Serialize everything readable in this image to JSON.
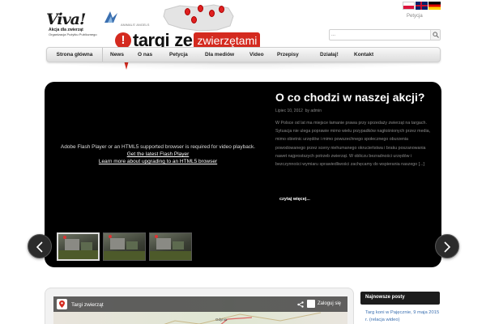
{
  "header": {
    "viva_logo": {
      "name": "Viva!",
      "tagline": "Akcja dla zwierząt",
      "subline": "Organizacja Pożytku Publicznego"
    },
    "animals_angels_logo": {
      "text": "ANIMALS' ANGELS"
    },
    "targi_logo": {
      "bang": "!",
      "word_targi": "targi",
      "word_ze": "ze",
      "word_zwierzetami": "zwierzętami"
    },
    "languages": [
      "pl",
      "en",
      "de"
    ],
    "petycja_link": "Petycja",
    "search": {
      "placeholder": "...",
      "value": ""
    }
  },
  "nav": {
    "items": [
      {
        "label": "Strona główna"
      },
      {
        "label": "News"
      },
      {
        "label": "O nas"
      },
      {
        "label": "Petycja"
      },
      {
        "label": "Dla mediów"
      },
      {
        "label": "Video"
      },
      {
        "label": "Przepisy"
      },
      {
        "label": "Działaj!"
      },
      {
        "label": "Kontakt"
      }
    ]
  },
  "slider": {
    "flash_message": "Adobe Flash Player or an HTML5 supported browser is required for video playback.",
    "flash_link1": "Get the latest Flash Player",
    "flash_link2": "Learn more about upgrading to an HTML5 browser",
    "title": "O co chodzi w naszej akcji?",
    "meta_date": "Lipiec 10, 2012",
    "meta_by": "by admin",
    "body": "W Polsce od lat ma miejsce łamanie prawa przy sprzedaży zwierząt na targach. Sytuacja nie ulega poprawie mimo wielu przypadków nagłośnionych przez media, mimo obietnic urzędów i mimo powszechnego społecznego oburzenia powodowanego przez sceny niehumanego okrucieństwa i braku poszanowania nawet najprostszych potrzeb zwierząt. W obliczu bezradności urzędów i bezczynności wymiaru sprawiedliwości zachęcamy do wspierania naszego [...]",
    "read_more": "czytaj więcej...",
    "thumbs": 3
  },
  "map": {
    "title": "Targi zwierząt",
    "login": "Zaloguj się",
    "town_label": "Gdynia"
  },
  "sidebar_widget": {
    "title": "Najnowsze posty",
    "item": "Targ koni w Pajęcznie, 9 maja 2015 r. (relacja wideo)"
  },
  "colors": {
    "brand_red": "#d42a1f",
    "link_blue": "#3a6fb0",
    "slider_bg": "#000000"
  }
}
